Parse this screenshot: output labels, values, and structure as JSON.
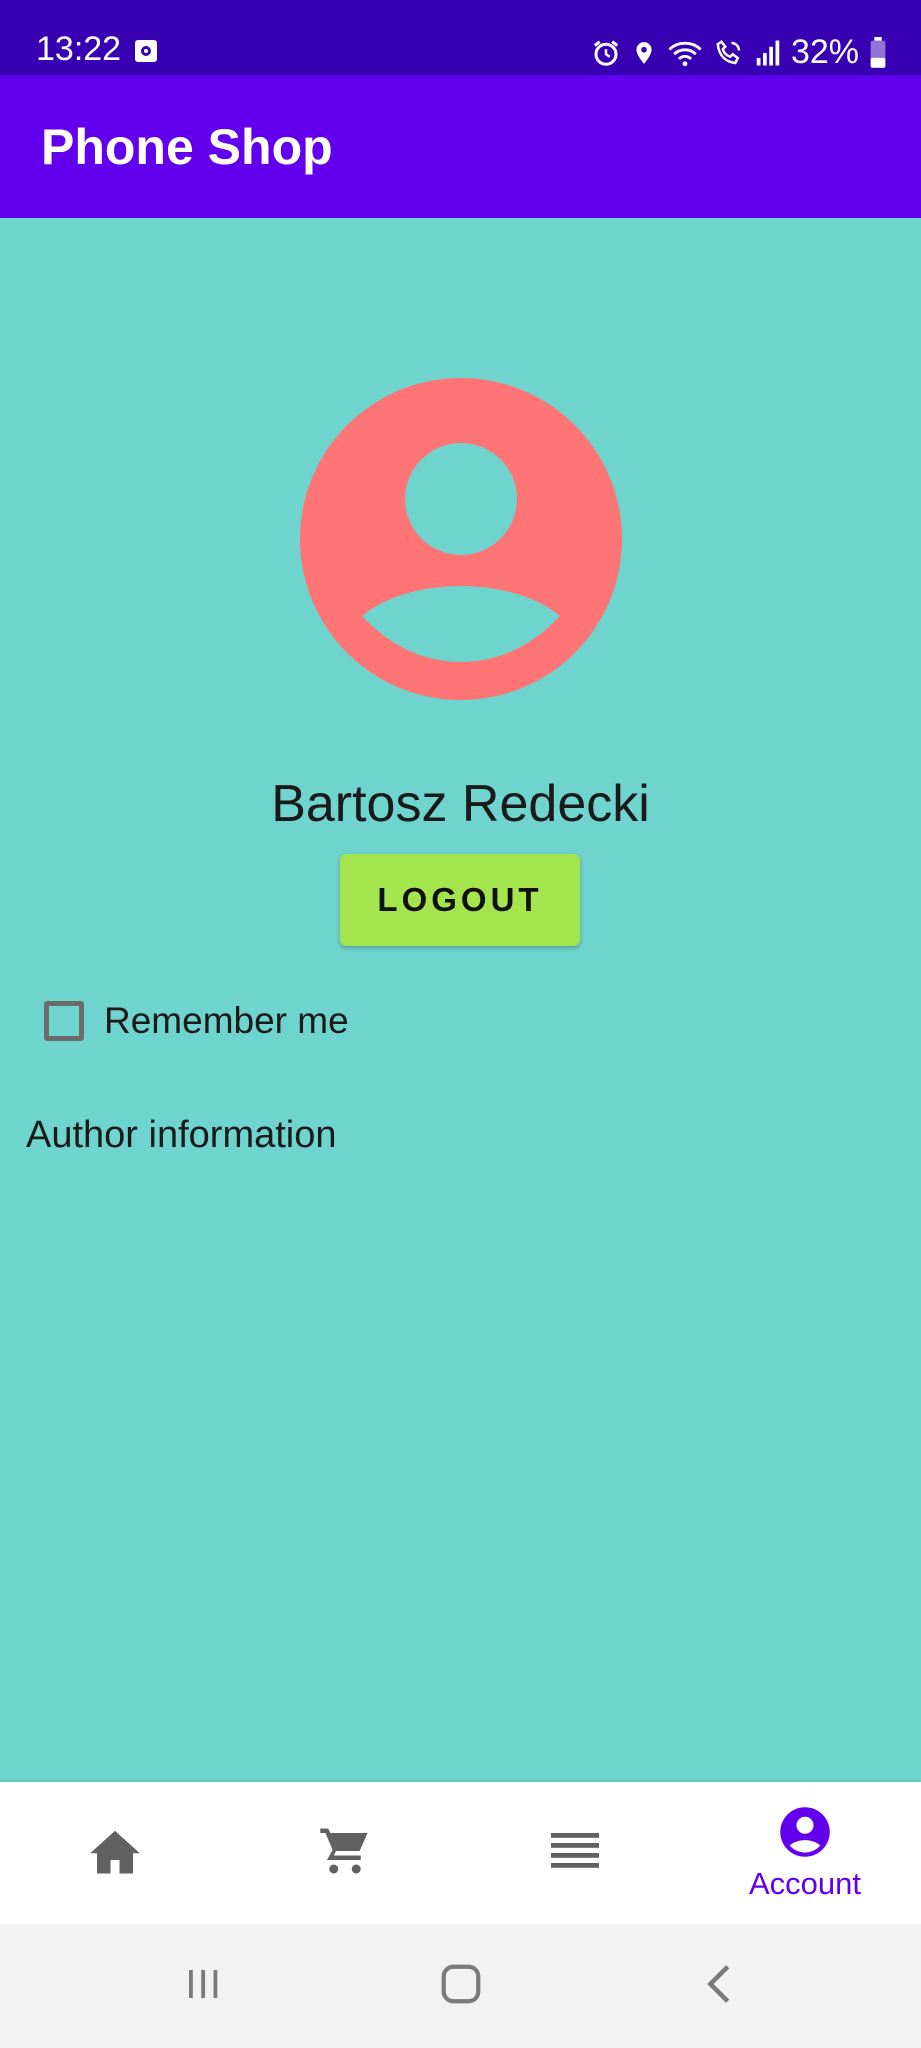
{
  "status_bar": {
    "time": "13:22",
    "battery": "32%",
    "icons": [
      "media-icon",
      "alarm-icon",
      "location-icon",
      "wifi-icon",
      "wifi-call-icon",
      "signal-icon",
      "battery-icon"
    ]
  },
  "app_bar": {
    "title": "Phone Shop"
  },
  "account": {
    "name": "Bartosz Redecki",
    "logout_label": "LOGOUT",
    "remember_label": "Remember me",
    "remember_checked": false,
    "author_info": "Author information"
  },
  "bottom_nav": {
    "items": [
      {
        "icon": "home-icon",
        "label": ""
      },
      {
        "icon": "cart-icon",
        "label": ""
      },
      {
        "icon": "list-icon",
        "label": ""
      },
      {
        "icon": "account-icon",
        "label": "Account",
        "selected": true
      }
    ]
  },
  "colors": {
    "status_bar": "#3700b3",
    "app_bar": "#6200ee",
    "background": "#6fd3ce",
    "avatar": "#ff7474",
    "logout_button": "#a4e44c",
    "nav_selected": "#6200ee",
    "nav_unselected": "#616161"
  }
}
